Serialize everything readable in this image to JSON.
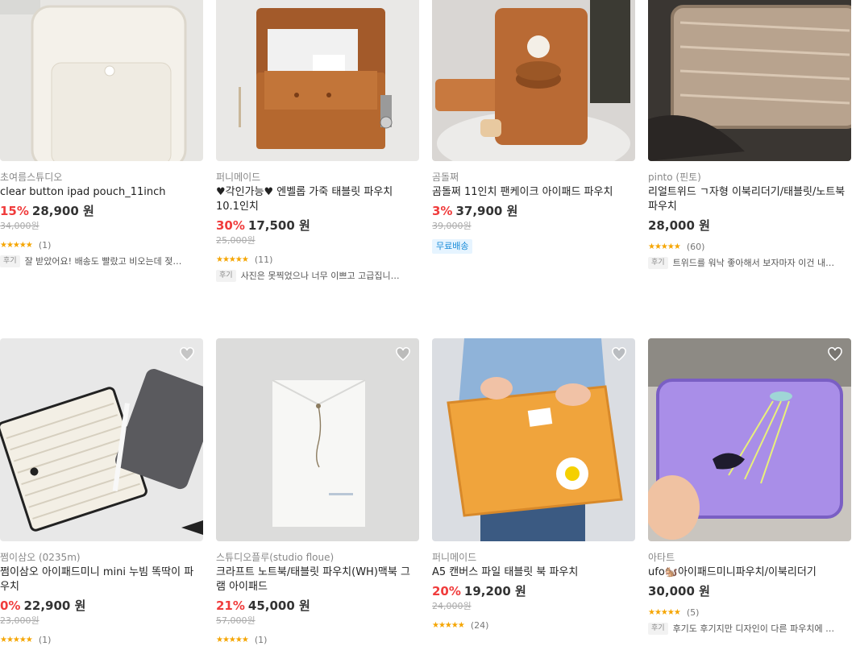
{
  "products": [
    {
      "seller": "초여름스튜디오",
      "title": "clear button ipad pouch_11inch",
      "discount": "15%",
      "price": "28,900 원",
      "original": "34,000원",
      "stars": "★★★★★",
      "reviews": "(1)",
      "review_tag": "후기",
      "review_text": "잘 받았어요! 배송도 빨랐고 비오는데 젖을..."
    },
    {
      "seller": "퍼니메이드",
      "title": "♥각인가능♥ 엔벨롭 가죽 태블릿 파우치 10.1인치",
      "discount": "30%",
      "price": "17,500 원",
      "original": "25,000원",
      "stars": "★★★★★",
      "reviews": "(11)",
      "review_tag": "후기",
      "review_text": "사진은 못찍었으나 너무 이쁘고 고급집니다! ..."
    },
    {
      "seller": "곰돌쩌",
      "title": "곰돌쩌 11인치 팬케이크 아이패드 파우치",
      "discount": "3%",
      "price": "37,900 원",
      "original": "39,000원",
      "badge": "무료배송"
    },
    {
      "seller": "pinto (핀토)",
      "title": "리얼트위드 ㄱ자형 이북리더기/태블릿/노트북 파우치",
      "price": "28,000 원",
      "stars": "★★★★★",
      "reviews": "(60)",
      "review_tag": "후기",
      "review_text": "트위드를 워낙 좋아해서 보자마자 이건 내거..."
    },
    {
      "seller": "쩜이삼오 (0235m)",
      "title": "쩜이삼오 아이패드미니 mini 누빔 똑딱이 파우치",
      "discount": "0%",
      "price": "22,900 원",
      "original": "23,000원",
      "stars": "★★★★★",
      "reviews": "(1)"
    },
    {
      "seller": "스튜디오플루(studio floue)",
      "title": "크라프트 노트북/태블릿 파우치(WH)맥북 그램 아이패드",
      "discount": "21%",
      "price": "45,000 원",
      "original": "57,000원",
      "stars": "★★★★★",
      "reviews": "(1)"
    },
    {
      "seller": "퍼니메이드",
      "title": "A5 캔버스 파일 태블릿 북 파우치",
      "discount": "20%",
      "price": "19,200 원",
      "original": "24,000원",
      "stars": "★★★★★",
      "reviews": "(24)"
    },
    {
      "seller": "아타트",
      "title": "ufo🐿️아이패드미니파우치/이북리더기",
      "price": "30,000 원",
      "stars": "★★★★★",
      "reviews": "(5)",
      "review_tag": "후기",
      "review_text": "후기도 후기지만 디자인이 다른 파우치에 비..."
    }
  ],
  "icons": {
    "wishlist": "heart-icon",
    "rating": "star-icon"
  },
  "colors": {
    "discount": "#f03c3c",
    "star": "#f5a500",
    "badge_bg": "#e6f4ff",
    "badge_text": "#1a8cd8"
  }
}
